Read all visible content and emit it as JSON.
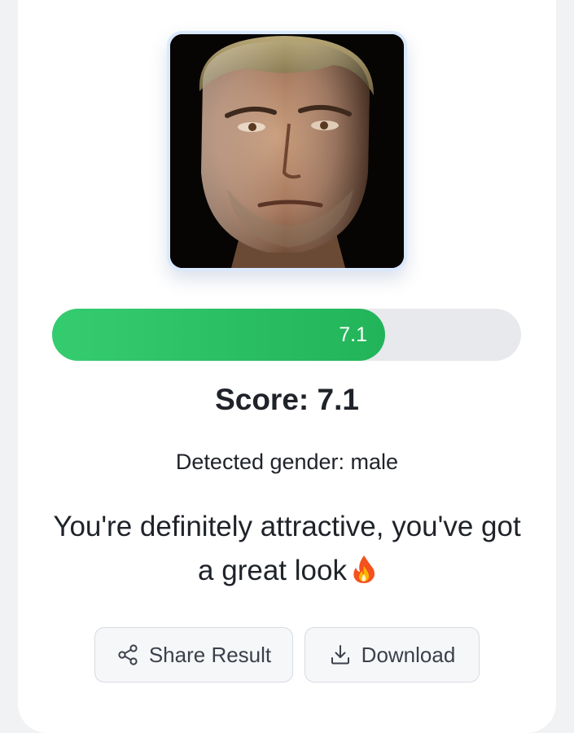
{
  "result": {
    "score_value": 7.1,
    "score_max": 10,
    "progress_label": "7.1",
    "score_text": "Score: 7.1",
    "gender_text": "Detected gender: male",
    "message": "You're definitely attractive, you've got a great look"
  },
  "actions": {
    "share_label": "Share Result",
    "download_label": "Download"
  },
  "colors": {
    "progress_fill": "#2dc467",
    "progress_track": "#e7e9ec",
    "photo_border": "#dbe9ff"
  },
  "icons": {
    "message_emoji": "fire-icon",
    "share": "share-icon",
    "download": "download-icon"
  }
}
